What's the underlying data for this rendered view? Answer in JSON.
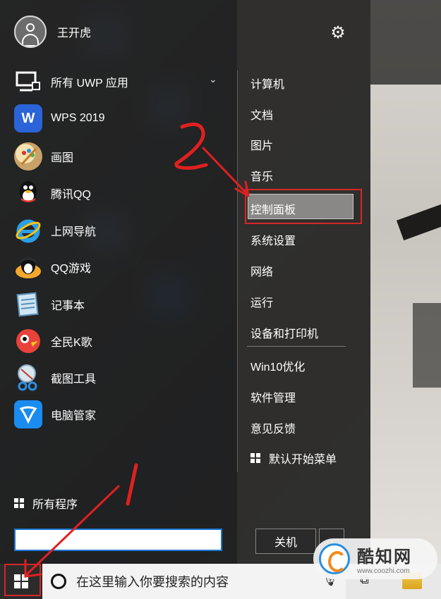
{
  "user": {
    "name": "王开虎"
  },
  "apps": [
    {
      "label": "所有 UWP 应用",
      "icon": "uwp-icon"
    },
    {
      "label": "WPS 2019",
      "icon": "wps-icon"
    },
    {
      "label": "画图",
      "icon": "paint-icon"
    },
    {
      "label": "腾讯QQ",
      "icon": "qq-icon"
    },
    {
      "label": "上网导航",
      "icon": "ie-icon"
    },
    {
      "label": "QQ游戏",
      "icon": "qq-game-icon"
    },
    {
      "label": "记事本",
      "icon": "notepad-icon"
    },
    {
      "label": "全民K歌",
      "icon": "karaoke-icon"
    },
    {
      "label": "截图工具",
      "icon": "snipping-tool-icon"
    },
    {
      "label": "电脑管家",
      "icon": "pc-manager-icon"
    }
  ],
  "links": [
    {
      "label": "计算机"
    },
    {
      "label": "文档"
    },
    {
      "label": "图片"
    },
    {
      "label": "音乐"
    },
    {
      "label": "控制面板"
    },
    {
      "label": "系统设置"
    },
    {
      "label": "网络"
    },
    {
      "label": "运行"
    },
    {
      "label": "设备和打印机"
    },
    {
      "label": "Win10优化"
    },
    {
      "label": "软件管理"
    },
    {
      "label": "意见反馈"
    },
    {
      "label": "默认开始菜单"
    }
  ],
  "all_programs_label": "所有程序",
  "shutdown_label": "关机",
  "taskbar": {
    "search_placeholder": "在这里输入你要搜索的内容"
  },
  "watermark": {
    "title": "酷知网",
    "url": "www.coozhi.com"
  },
  "annotations": {
    "step1": "1",
    "step2": "2"
  },
  "colors": {
    "highlight_red": "#d42727",
    "menu_bg": "#1e1f21",
    "hover_bg": "#8a8886"
  }
}
